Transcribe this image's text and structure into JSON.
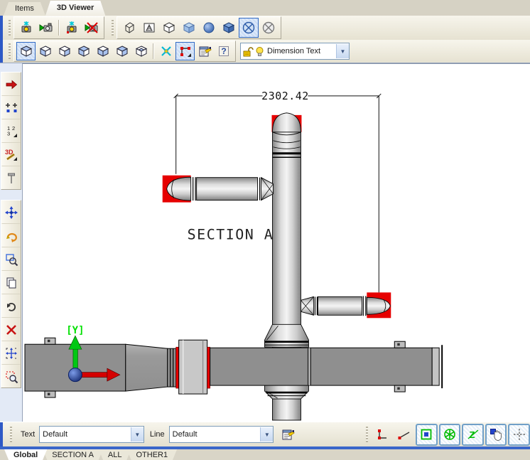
{
  "tabs_top": [
    {
      "label": "Items",
      "active": false
    },
    {
      "label": "3D Viewer",
      "active": true
    }
  ],
  "toolbars": {
    "camera_group_icons": [
      "snapshot-camera",
      "record-camera",
      "snapshot-camera-marker",
      "record-camera-off"
    ],
    "display_group_icons": [
      "wireframe-cube",
      "annotation-display",
      "hidden-line-cube",
      "flat-shaded-cube",
      "smooth-sphere",
      "shaded-edges-cube",
      "perspective-sphere-on",
      "perspective-sphere-off"
    ],
    "view_group_icons": [
      "view-top",
      "view-bottom",
      "view-left",
      "view-right",
      "view-front",
      "view-back",
      "view-iso"
    ],
    "tool_icons": [
      "axes-cross",
      "dimension-nodes",
      "properties",
      "help"
    ],
    "style_combo": {
      "value": "Dimension Text",
      "icons": [
        "lock-open",
        "lightbulb"
      ]
    }
  },
  "left_toolbar": {
    "group1_icons": [
      "red-arrow",
      "snap-points",
      "numbering",
      "edit-3d",
      "pin"
    ],
    "group2_icons": [
      "pan",
      "orbit",
      "zoom-region",
      "copy",
      "refresh",
      "delete",
      "zoom-extents",
      "zoom-window"
    ]
  },
  "bottom_bar": {
    "text_label": "Text",
    "text_value": "Default",
    "line_label": "Line",
    "line_value": "Default",
    "icons": [
      "properties",
      "ortho-dimension",
      "aligned-dimension",
      "snap-node",
      "snap-center",
      "snap-nearest",
      "pan-hand",
      "crosshair"
    ],
    "toggled_on": [
      "snap-node",
      "snap-center",
      "snap-nearest",
      "pan-hand",
      "crosshair"
    ]
  },
  "sheet_tabs": [
    {
      "label": "Global",
      "active": true
    },
    {
      "label": "SECTION A",
      "active": false
    },
    {
      "label": "ALL",
      "active": false
    },
    {
      "label": "OTHER1",
      "active": false
    }
  ],
  "viewport": {
    "dimension_value": "2302.42",
    "section_label": "SECTION A",
    "axis_label": "[Y]",
    "colors": {
      "selection_red": "#E60000",
      "axis_y_green": "#00C814",
      "axis_x_red": "#D40000",
      "duct_gray": "#8F8F8F"
    }
  }
}
